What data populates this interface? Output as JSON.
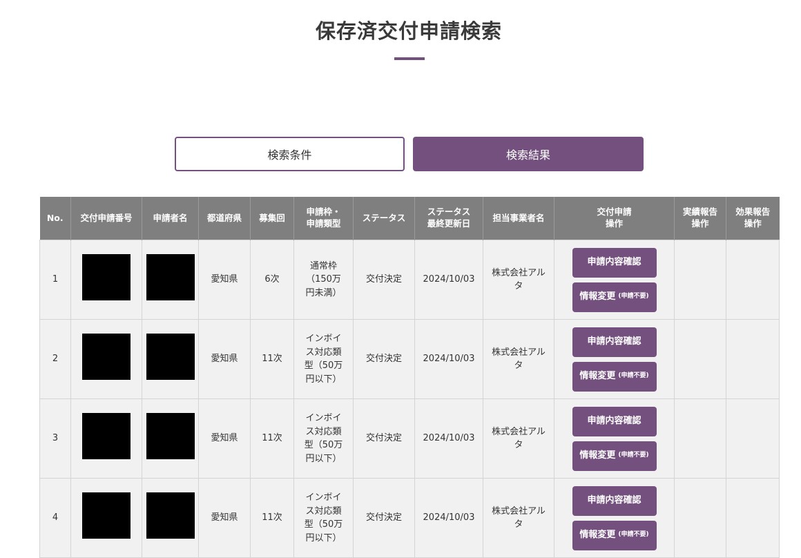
{
  "page": {
    "title": "保存済交付申請検索"
  },
  "tabs": {
    "conditions": "検索条件",
    "results": "検索結果"
  },
  "table": {
    "headers": [
      [
        "No."
      ],
      [
        "交付申請番号"
      ],
      [
        "申請者名"
      ],
      [
        "都道府県"
      ],
      [
        "募集回"
      ],
      [
        "申請枠・",
        "申請類型"
      ],
      [
        "ステータス"
      ],
      [
        "ステータス",
        "最終更新日"
      ],
      [
        "担当事業者名"
      ],
      [
        "交付申請",
        "操作"
      ],
      [
        "実績報告",
        "操作"
      ],
      [
        "効果報告",
        "操作"
      ]
    ],
    "rows": [
      {
        "no": "1",
        "prefecture": "愛知県",
        "round": "6次",
        "category": [
          "通常枠",
          "（150万",
          "円未満）"
        ],
        "status": "交付決定",
        "updated": "2024/10/03",
        "vendor": [
          "株式会社アル",
          "タ"
        ]
      },
      {
        "no": "2",
        "prefecture": "愛知県",
        "round": "11次",
        "category": [
          "インボイ",
          "ス対応類",
          "型（50万",
          "円以下）"
        ],
        "status": "交付決定",
        "updated": "2024/10/03",
        "vendor": [
          "株式会社アル",
          "タ"
        ]
      },
      {
        "no": "3",
        "prefecture": "愛知県",
        "round": "11次",
        "category": [
          "インボイ",
          "ス対応類",
          "型（50万",
          "円以下）"
        ],
        "status": "交付決定",
        "updated": "2024/10/03",
        "vendor": [
          "株式会社アル",
          "タ"
        ]
      },
      {
        "no": "4",
        "prefecture": "愛知県",
        "round": "11次",
        "category": [
          "インボイ",
          "ス対応類",
          "型（50万",
          "円以下）"
        ],
        "status": "交付決定",
        "updated": "2024/10/03",
        "vendor": [
          "株式会社アル",
          "タ"
        ]
      }
    ],
    "buttons": {
      "confirm": "申請内容確認",
      "change": "情報変更",
      "change_note": "(申請不要)"
    }
  },
  "colors": {
    "accent": "#74507f",
    "header_bg": "#7f7f7f",
    "row_bg": "#f1f1f1"
  }
}
